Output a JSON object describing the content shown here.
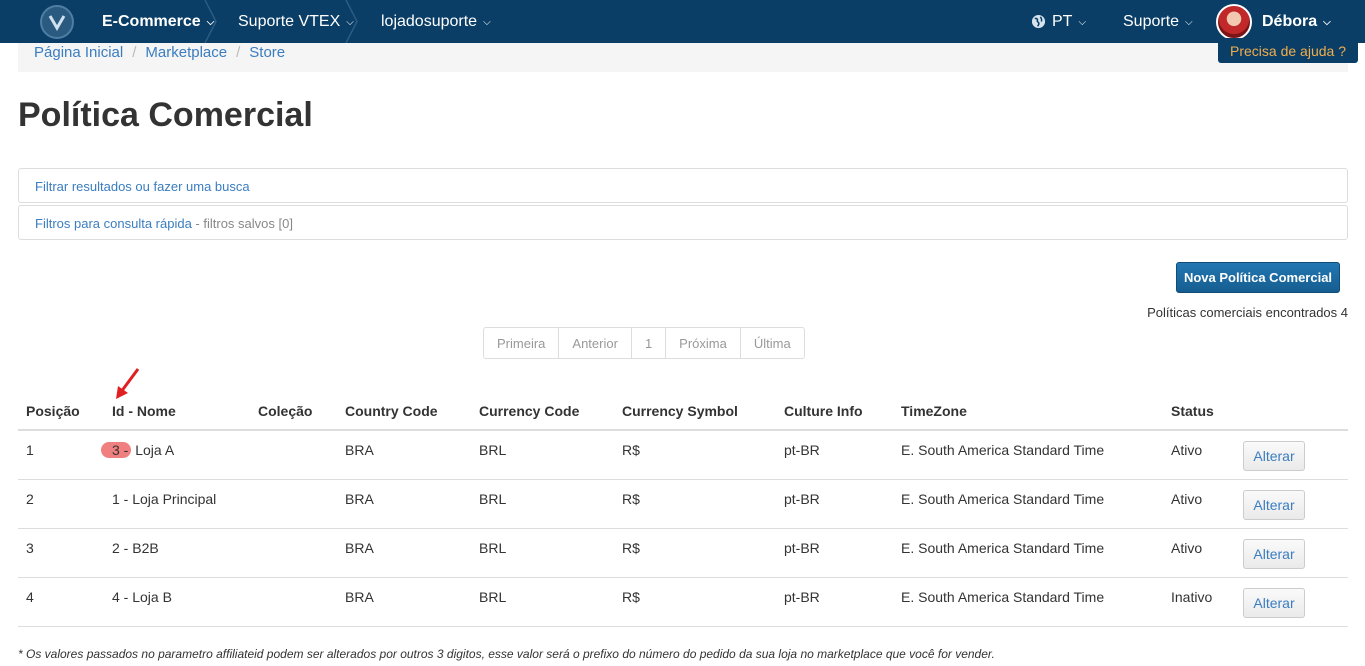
{
  "navbar": {
    "product": "E-Commerce",
    "account": "Suporte VTEX",
    "store": "lojadosuporte",
    "language": "PT",
    "support": "Suporte",
    "user": "Débora",
    "caret": "⌄"
  },
  "help_button": "Precisa de ajuda ?",
  "breadcrumb": [
    "Página Inicial",
    "Marketplace",
    "Store"
  ],
  "page_title": "Política Comercial",
  "filters": {
    "search_link": "Filtrar resultados ou fazer uma busca",
    "quick_link": "Filtros para consulta rápida",
    "saved_text": " - filtros salvos [0]"
  },
  "new_button": "Nova Política Comercial",
  "results_text": "Políticas comerciais encontrados 4",
  "pagination": [
    "Primeira",
    "Anterior",
    "1",
    "Próxima",
    "Última"
  ],
  "table": {
    "headers": [
      "Posição",
      "Id - Nome",
      "Coleção",
      "Country Code",
      "Currency Code",
      "Currency Symbol",
      "Culture Info",
      "TimeZone",
      "Status"
    ],
    "rows": [
      {
        "pos": "1",
        "id": "3 -",
        "name": " Loja A",
        "colecao": "",
        "country": "BRA",
        "currency": "BRL",
        "symbol": "R$",
        "culture": "pt-BR",
        "tz": "E. South America Standard Time",
        "status": "Ativo",
        "action": "Alterar"
      },
      {
        "pos": "2",
        "id": "1 -",
        "name": " Loja Principal",
        "colecao": "",
        "country": "BRA",
        "currency": "BRL",
        "symbol": "R$",
        "culture": "pt-BR",
        "tz": "E. South America Standard Time",
        "status": "Ativo",
        "action": "Alterar"
      },
      {
        "pos": "3",
        "id": "2 -",
        "name": " B2B",
        "colecao": "",
        "country": "BRA",
        "currency": "BRL",
        "symbol": "R$",
        "culture": "pt-BR",
        "tz": "E. South America Standard Time",
        "status": "Ativo",
        "action": "Alterar"
      },
      {
        "pos": "4",
        "id": "4 -",
        "name": " Loja B",
        "colecao": "",
        "country": "BRA",
        "currency": "BRL",
        "symbol": "R$",
        "culture": "pt-BR",
        "tz": "E. South America Standard Time",
        "status": "Inativo",
        "action": "Alterar"
      }
    ]
  },
  "footnote": "* Os valores passados no parametro affiliateid podem ser alterados por outros 3 digitos, esse valor será o prefixo do número do pedido da sua loja no marketplace que você for vender.",
  "colors": {
    "navbar": "#0a3e66",
    "link": "#3a7dc0",
    "highlight": "#f08080",
    "arrow": "#e02020"
  }
}
